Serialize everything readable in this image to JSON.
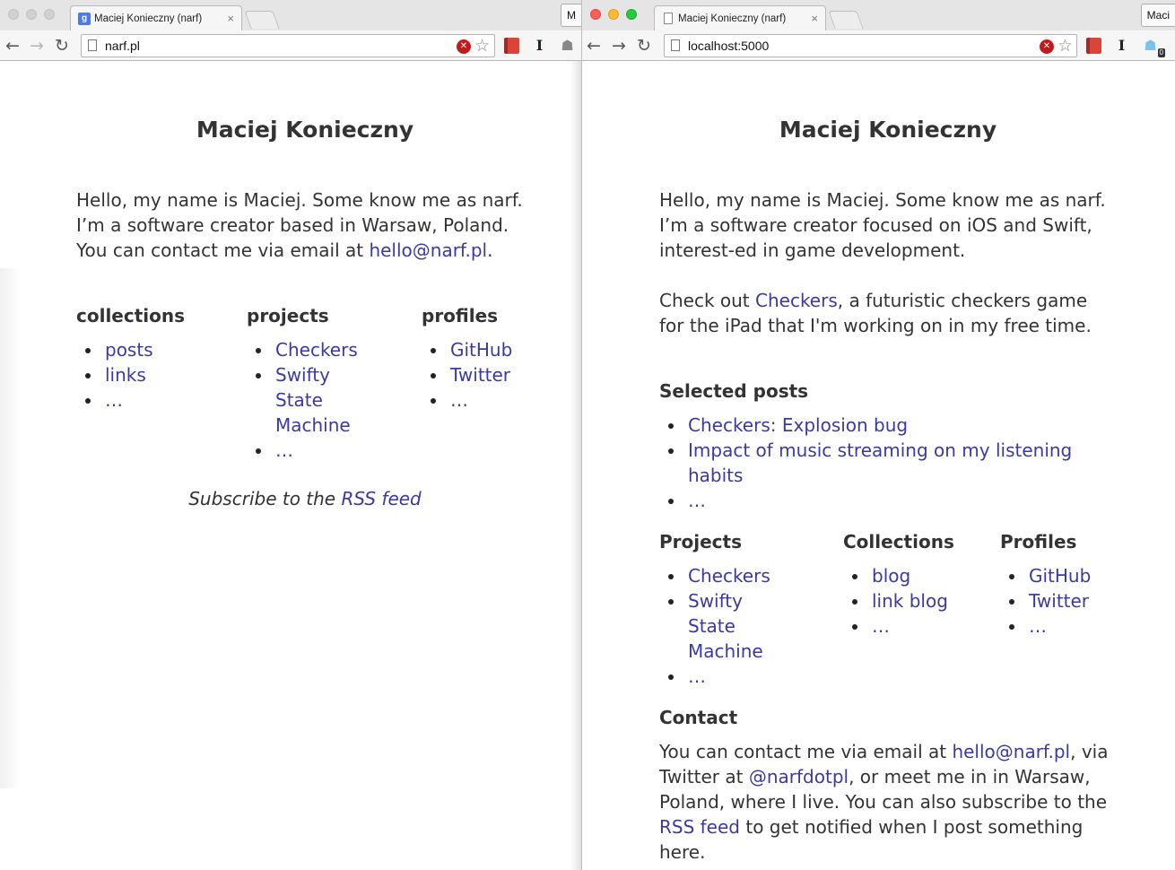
{
  "left_window": {
    "tab": {
      "title": "Maciej Konieczny (narf)",
      "close": "×"
    },
    "profile_chip": "M",
    "address": "narf.pl",
    "icons": {
      "back": "back-arrow-icon",
      "forward": "forward-arrow-icon",
      "reload": "reload-icon"
    },
    "page": {
      "title": "Maciej Konieczny",
      "intro_text": "Hello, my name is Maciej. Some know me as narf. I’m a software creator based in Warsaw, Poland. You can contact me via email at ",
      "intro_email": "hello@narf.pl",
      "intro_end": ".",
      "columns": [
        {
          "heading": "collections",
          "items": [
            "posts",
            "links",
            "…"
          ]
        },
        {
          "heading": "projects",
          "items": [
            "Checkers",
            "Swifty State Machine",
            "…"
          ]
        },
        {
          "heading": "profiles",
          "items": [
            "GitHub",
            "Twitter",
            "…"
          ]
        }
      ],
      "subscribe_text": "Subscribe to the ",
      "subscribe_link": "RSS feed"
    }
  },
  "right_window": {
    "tab": {
      "title": "Maciej Konieczny (narf)",
      "close": "×"
    },
    "profile_chip": "Maci",
    "address": "localhost:5000",
    "extension_badge": "0",
    "page": {
      "title": "Maciej Konieczny",
      "intro": "Hello, my name is Maciej. Some know me as narf. I’m a software creator focused on iOS and Swift, interest-ed in game development.",
      "checkout_pre": "Check out ",
      "checkout_link": "Checkers",
      "checkout_post": ", a futuristic checkers game for the iPad that I'm working on in my free time.",
      "selected_posts": {
        "heading": "Selected posts",
        "items": [
          "Checkers: Explosion bug",
          "Impact of music streaming on my listening habits",
          "…"
        ]
      },
      "columns": [
        {
          "heading": "Projects",
          "items": [
            "Checkers",
            "Swifty State Machine",
            "…"
          ]
        },
        {
          "heading": "Collections",
          "items": [
            "blog",
            "link blog",
            "…"
          ]
        },
        {
          "heading": "Profiles",
          "items": [
            "GitHub",
            "Twitter",
            "…"
          ]
        }
      ],
      "contact": {
        "heading": "Contact",
        "t1": "You can contact me via email at ",
        "email": "hello@narf.pl",
        "t2": ", via Twitter at ",
        "twitter": "@narfdotpl",
        "t3": ", or meet me in in Warsaw, Poland, where I live. You can also subscribe to the ",
        "rss": "RSS feed",
        "t4": " to get notified when I post something here."
      }
    }
  }
}
